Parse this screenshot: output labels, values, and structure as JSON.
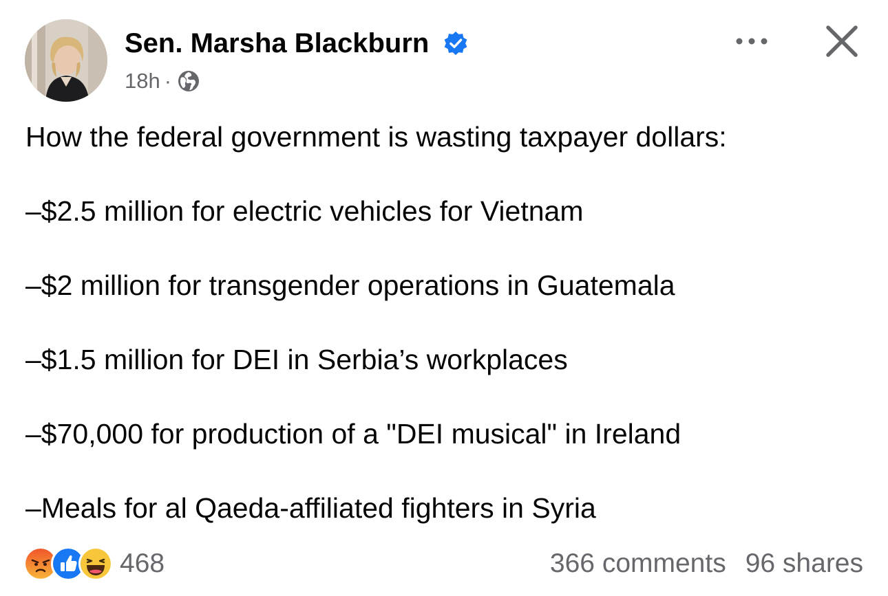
{
  "post": {
    "author": "Sen. Marsha Blackburn",
    "verified_icon": "verified-badge-icon",
    "time": "18h",
    "separator": "·",
    "audience_icon": "globe-icon",
    "more_icon": "more-horizontal-icon",
    "close_icon": "close-icon",
    "text_lines": [
      "How the federal government is wasting taxpayer dollars:",
      "–$2.5 million for electric vehicles for Vietnam",
      "–$2 million for transgender operations in Guatemala",
      "–$1.5 million for DEI in Serbia’s workplaces",
      "–$70,000 for production of a \"DEI musical\" in Ireland",
      "–Meals for al Qaeda-affiliated fighters in Syria"
    ],
    "reactions": {
      "icons": [
        "angry-reaction-icon",
        "like-reaction-icon",
        "haha-reaction-icon"
      ],
      "count": "468"
    },
    "comments": "366 comments",
    "shares": "96 shares"
  },
  "colors": {
    "accent_blue": "#1877f2",
    "secondary_text": "#65676b",
    "primary_text": "#050505"
  }
}
